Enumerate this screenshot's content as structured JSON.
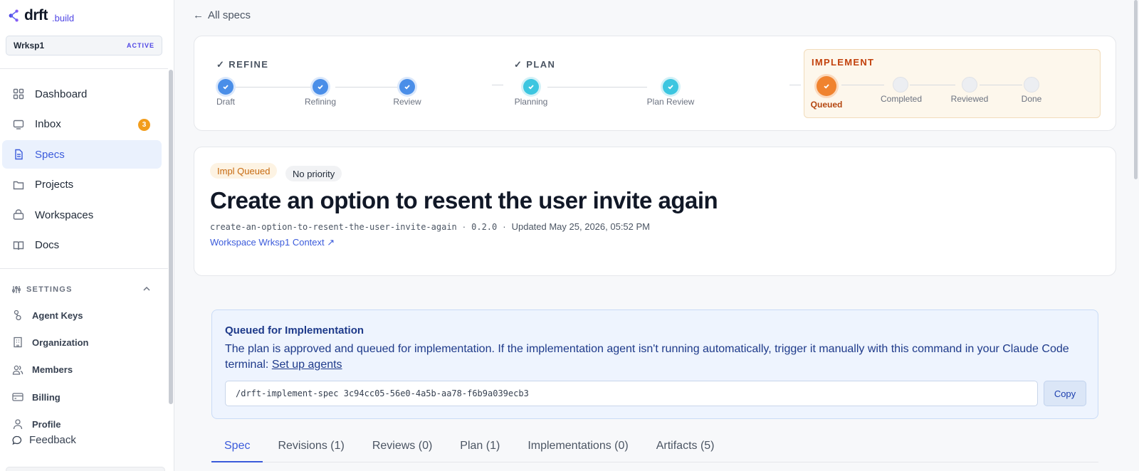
{
  "brand": {
    "name": "drft",
    "suffix": ".build"
  },
  "workspace": {
    "name": "Wrksp1",
    "status": "ACTIVE"
  },
  "nav": [
    {
      "label": "Dashboard",
      "icon": "grid-icon"
    },
    {
      "label": "Inbox",
      "icon": "inbox-icon",
      "badge": "3"
    },
    {
      "label": "Specs",
      "icon": "document-icon",
      "active": true
    },
    {
      "label": "Projects",
      "icon": "folder-icon"
    },
    {
      "label": "Workspaces",
      "icon": "briefcase-icon"
    },
    {
      "label": "Docs",
      "icon": "book-icon"
    }
  ],
  "settings": {
    "title": "SETTINGS",
    "items": [
      "Agent Keys",
      "Organization",
      "Members",
      "Billing",
      "Profile"
    ]
  },
  "feedback": "Feedback",
  "back_link": "All specs",
  "progress": {
    "refine": {
      "title": "✓ REFINE",
      "steps": [
        "Draft",
        "Refining",
        "Review"
      ]
    },
    "plan": {
      "title": "✓ PLAN",
      "steps": [
        "Planning",
        "Plan Review"
      ]
    },
    "implement": {
      "title": "IMPLEMENT",
      "steps": [
        "Queued",
        "Completed",
        "Reviewed",
        "Done"
      ],
      "current": "Queued"
    }
  },
  "spec": {
    "status_pill": "Impl Queued",
    "priority_pill": "No priority",
    "title": "Create an option to resent the user invite again",
    "slug": "create-an-option-to-resent-the-user-invite-again",
    "version": "0.2.0",
    "updated": "Updated May 25, 2026, 05:52 PM",
    "sep": "·",
    "context_link": "Workspace Wrksp1 Context ↗"
  },
  "queue": {
    "title": "Queued for Implementation",
    "text": "The plan is approved and queued for implementation. If the implementation agent isn't running automatically, trigger it manually with this command in your Claude Code terminal:",
    "link": "Set up agents",
    "command": "/drft-implement-spec 3c94cc05-56e0-4a5b-aa78-f6b9a039ecb3",
    "copy_label": "Copy"
  },
  "tabs": [
    "Spec",
    "Revisions (1)",
    "Reviews (0)",
    "Plan (1)",
    "Implementations (0)",
    "Artifacts (5)"
  ],
  "colors": {
    "accent": "#3b5bdb",
    "warning": "#f0832f",
    "badge": "#f29d1c"
  }
}
